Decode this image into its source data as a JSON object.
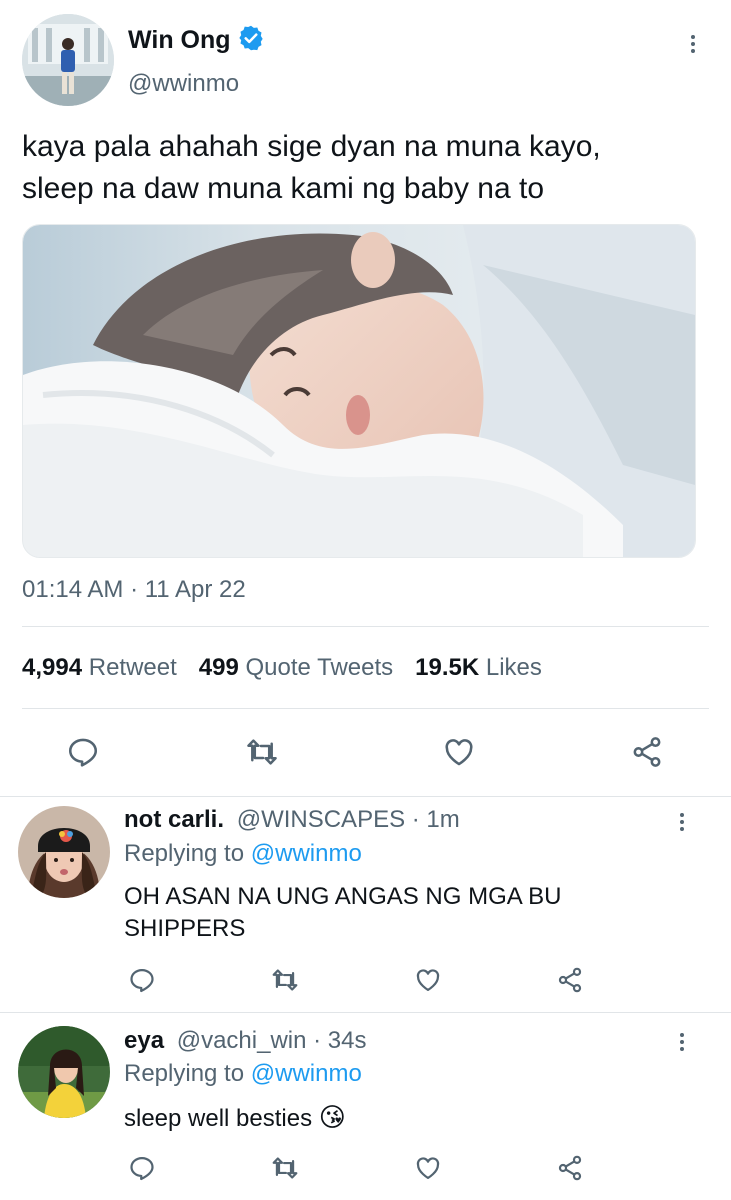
{
  "tweet": {
    "name": "Win Ong",
    "handle": "@wwinmo",
    "text_line1": "kaya pala ahahah sige dyan na muna kayo,",
    "text_line2": "sleep na daw muna kami ng baby na to",
    "timestamp": "01:14 AM · 11 Apr 22",
    "retweets_count": "4,994",
    "retweets_label": "Retweet",
    "quotes_count": "499",
    "quotes_label": "Quote Tweets",
    "likes_count": "19.5K",
    "likes_label": "Likes"
  },
  "replies": [
    {
      "name": "not carli.",
      "handle": "@WINSCAPES",
      "time": "· 1m",
      "replying_label": "Replying to",
      "replying_to": "@wwinmo",
      "text_line1": "OH ASAN NA UNG ANGAS NG MGA BU",
      "text_line2": "SHIPPERS"
    },
    {
      "name": "eya",
      "handle": "@vachi_win",
      "time": "· 34s",
      "replying_label": "Replying to",
      "replying_to": "@wwinmo",
      "text_line1": "sleep well besties",
      "emoji": "😘"
    }
  ],
  "colors": {
    "accent": "#1d9bf0",
    "muted": "#536471",
    "text": "#0f1419",
    "divider": "#e1e5e8"
  },
  "icons": [
    "verified-badge-icon",
    "more-options-icon",
    "reply-icon",
    "retweet-icon",
    "like-icon",
    "share-icon"
  ]
}
